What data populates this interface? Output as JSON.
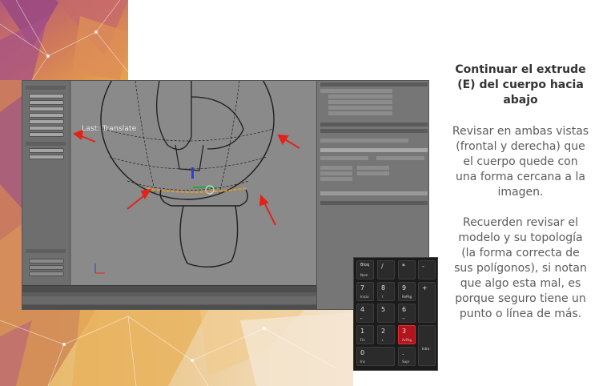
{
  "slide": {
    "heading": "Continuar el extrude (E) del cuerpo hacia abajo",
    "paragraph1": "Revisar en ambas vistas (frontal y derecha) que el cuerpo quede con una forma cercana a la imagen.",
    "paragraph2": "Recuerden revisar el modelo y su topología (la forma correcta de sus polígonos), si notan que algo esta mal, es porque seguro tiene un punto o línea de más."
  },
  "blender_screenshot": {
    "operator_label": "Last: Translate",
    "accent_color": "#e2231a"
  },
  "keypad": {
    "keys": [
      {
        "main": "Bloq",
        "sub": "Num"
      },
      {
        "main": "/",
        "sub": ""
      },
      {
        "main": "*",
        "sub": ""
      },
      {
        "main": "-",
        "sub": ""
      },
      {
        "main": "7",
        "sub": "Inicio"
      },
      {
        "main": "8",
        "sub": ""
      },
      {
        "main": "9",
        "sub": "RePág"
      },
      {
        "main": "+",
        "sub": ""
      },
      {
        "main": "4",
        "sub": ""
      },
      {
        "main": "5",
        "sub": ""
      },
      {
        "main": "6",
        "sub": ""
      },
      {
        "main": "1",
        "sub": "Fin"
      },
      {
        "main": "2",
        "sub": ""
      },
      {
        "main": "3",
        "sub": "AvPág"
      },
      {
        "main": "Intro",
        "sub": ""
      },
      {
        "main": "0",
        "sub": "Ins"
      },
      {
        "main": ".",
        "sub": "Supr"
      }
    ],
    "highlight_color": "#b3131b"
  },
  "colors": {
    "background_art": [
      "#c8735c",
      "#e9a24a",
      "#9a4a7a",
      "#d9c2a8"
    ]
  }
}
